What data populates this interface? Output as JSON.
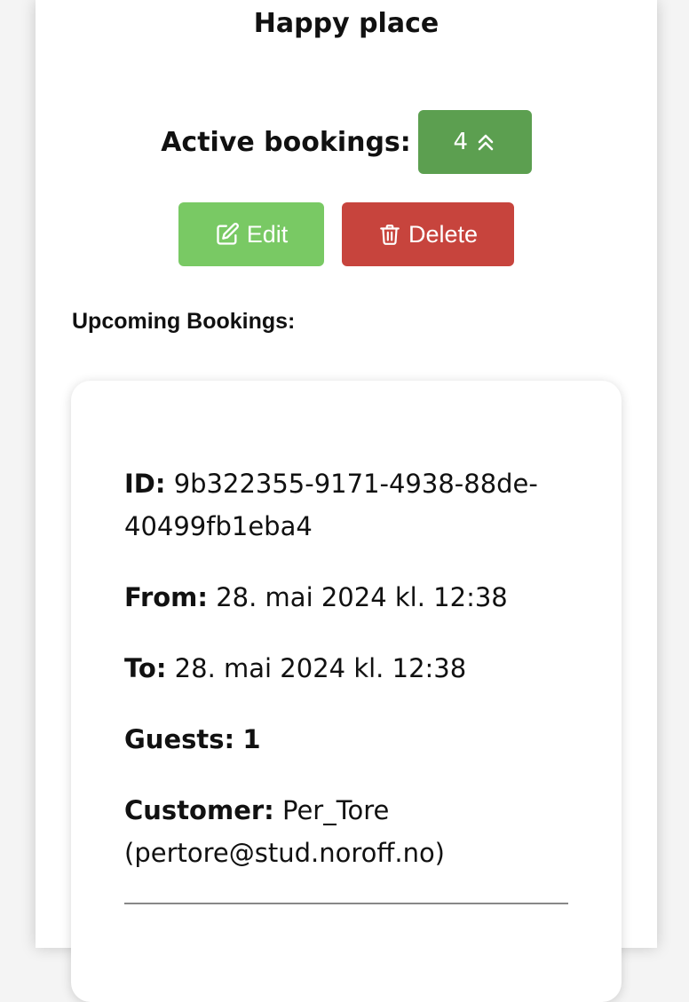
{
  "venue": {
    "title": "Happy place"
  },
  "active_bookings": {
    "label": "Active bookings:",
    "count": "4",
    "icon": "chevrons-up-icon"
  },
  "actions": {
    "edit_label": "Edit",
    "edit_icon": "edit-icon",
    "delete_label": "Delete",
    "delete_icon": "trash-icon"
  },
  "upcoming": {
    "heading": "Upcoming Bookings:",
    "bookings": [
      {
        "id_label": "ID:",
        "id": "9b322355-9171-4938-88de-40499fb1eba4",
        "from_label": "From:",
        "from": "28. mai 2024 kl. 12:38",
        "to_label": "To:",
        "to": "28. mai 2024 kl. 12:38",
        "guests_label": "Guests:",
        "guests": "1",
        "customer_label": "Customer:",
        "customer": "Per_Tore (pertore@stud.noroff.no)"
      }
    ]
  },
  "colors": {
    "count_button": "#5c9f50",
    "edit_button": "#79c964",
    "delete_button": "#c7443d"
  }
}
